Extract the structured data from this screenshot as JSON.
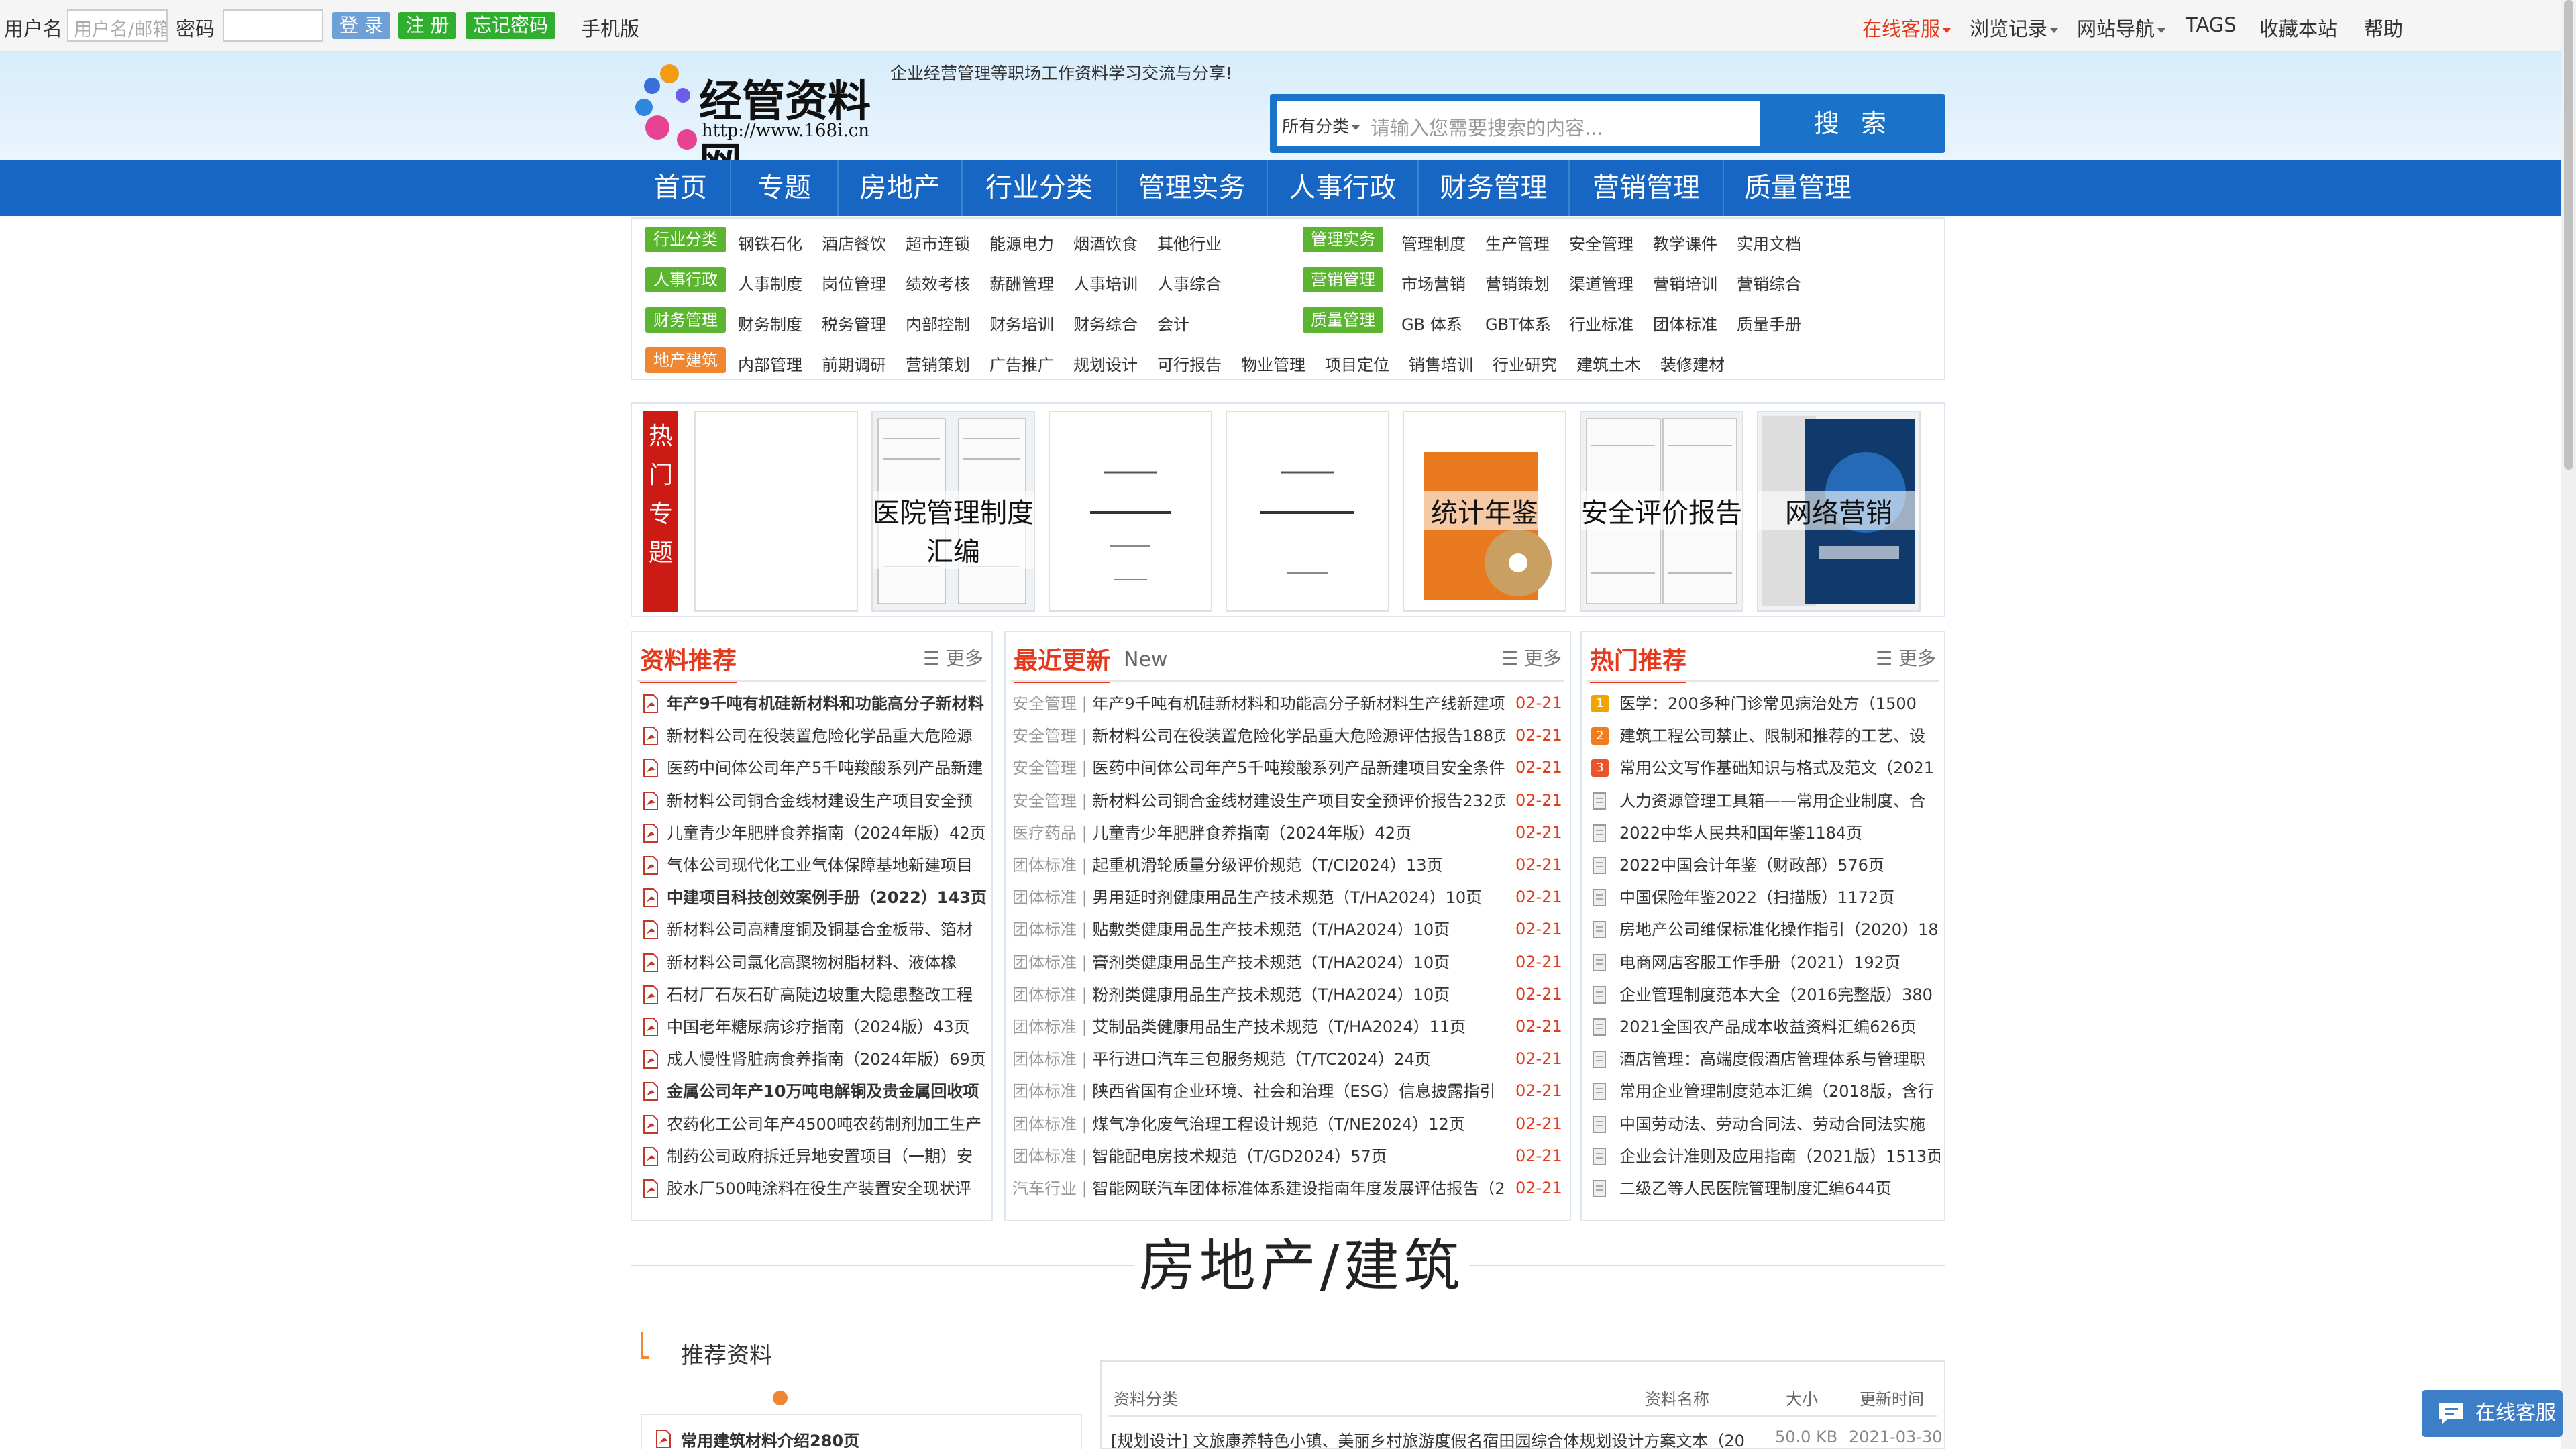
{
  "topbar": {
    "username_label": "用户名",
    "username_placeholder": "用户名/邮箱",
    "password_label": "密码",
    "login": "登 录",
    "register": "注 册",
    "forgot": "忘记密码",
    "mobile": "手机版",
    "right": [
      "在线客服",
      "浏览记录",
      "网站导航",
      "TAGS",
      "收藏本站",
      "帮助"
    ]
  },
  "header": {
    "slogan": "企业经营管理等职场工作资料学习交流与分享!",
    "logo_text": "经管资料网",
    "logo_url": "http://www.168i.cn",
    "search": {
      "category": "所有分类",
      "placeholder": "请输入您需要搜索的内容...",
      "button": "搜 索"
    }
  },
  "nav": [
    "首页",
    "专题",
    "房地产",
    "行业分类",
    "管理实务",
    "人事行政",
    "财务管理",
    "营销管理",
    "质量管理"
  ],
  "categories": [
    {
      "tag": "行业分类",
      "color": "green",
      "links": [
        "钢铁石化",
        "酒店餐饮",
        "超市连锁",
        "能源电力",
        "烟酒饮食",
        "其他行业"
      ],
      "tag2": "管理实务",
      "links2": [
        "管理制度",
        "生产管理",
        "安全管理",
        "教学课件",
        "实用文档"
      ]
    },
    {
      "tag": "人事行政",
      "color": "green",
      "links": [
        "人事制度",
        "岗位管理",
        "绩效考核",
        "薪酬管理",
        "人事培训",
        "人事综合"
      ],
      "tag2": "营销管理",
      "links2": [
        "市场营销",
        "营销策划",
        "渠道管理",
        "营销培训",
        "营销综合"
      ]
    },
    {
      "tag": "财务管理",
      "color": "green",
      "links": [
        "财务制度",
        "税务管理",
        "内部控制",
        "财务培训",
        "财务综合",
        "会计"
      ],
      "tag2": "质量管理",
      "links2": [
        "GB 体系",
        "GBT体系",
        "行业标准",
        "团体标准",
        "质量手册"
      ]
    },
    {
      "tag": "地产建筑",
      "color": "orange",
      "links": [
        "内部管理",
        "前期调研",
        "营销策划",
        "广告推广",
        "规划设计",
        "可行报告",
        "物业管理",
        "项目定位",
        "销售培训",
        "行业研究",
        "建筑土木",
        "装修建材"
      ],
      "tag2": "",
      "links2": []
    }
  ],
  "hot": {
    "label": [
      "热",
      "门",
      "专",
      "题"
    ],
    "captions": [
      "",
      "医院管理制度汇编",
      "",
      "",
      "统计年鉴",
      "安全评价报告",
      "网络营销"
    ]
  },
  "panels": {
    "recommend": {
      "title": "资料推荐",
      "more": "更多",
      "items": [
        {
          "t": "年产9千吨有机硅新材料和功能高分子新材料",
          "b": true
        },
        {
          "t": "新材料公司在役装置危险化学品重大危险源",
          "b": false
        },
        {
          "t": "医药中间体公司年产5千吨羧酸系列产品新建",
          "b": false
        },
        {
          "t": "新材料公司铜合金线材建设生产项目安全预",
          "b": false
        },
        {
          "t": "儿童青少年肥胖食养指南（2024年版）42页",
          "b": false
        },
        {
          "t": "气体公司现代化工业气体保障基地新建项目",
          "b": false
        },
        {
          "t": "中建项目科技创效案例手册（2022）143页",
          "b": true
        },
        {
          "t": "新材料公司高精度铜及铜基合金板带、箔材",
          "b": false
        },
        {
          "t": "新材料公司氯化高聚物树脂材料、液体橡",
          "b": false
        },
        {
          "t": "石材厂石灰石矿高陡边坡重大隐患整改工程",
          "b": false
        },
        {
          "t": "中国老年糖尿病诊疗指南（2024版）43页",
          "b": false
        },
        {
          "t": "成人慢性肾脏病食养指南（2024年版）69页",
          "b": false
        },
        {
          "t": "金属公司年产10万吨电解铜及贵金属回收项",
          "b": true
        },
        {
          "t": "农药化工公司年产4500吨农药制剂加工生产",
          "b": false
        },
        {
          "t": "制药公司政府拆迁异地安置项目（一期）安",
          "b": false
        },
        {
          "t": "胶水厂500吨涂料在役生产装置安全现状评",
          "b": false
        }
      ]
    },
    "recent": {
      "title": "最近更新",
      "sub": "New",
      "more": "更多",
      "items": [
        {
          "c": "安全管理",
          "t": "年产9千吨有机硅新材料和功能高分子新材料生产线新建项",
          "d": "02-21"
        },
        {
          "c": "安全管理",
          "t": "新材料公司在役装置危险化学品重大危险源评估报告188页",
          "d": "02-21"
        },
        {
          "c": "安全管理",
          "t": "医药中间体公司年产5千吨羧酸系列产品新建项目安全条件",
          "d": "02-21"
        },
        {
          "c": "安全管理",
          "t": "新材料公司铜合金线材建设生产项目安全预评价报告232页",
          "d": "02-21"
        },
        {
          "c": "医疗药品",
          "t": "儿童青少年肥胖食养指南（2024年版）42页",
          "d": "02-21"
        },
        {
          "c": "团体标准",
          "t": "起重机滑轮质量分级评价规范（T/CI2024）13页",
          "d": "02-21"
        },
        {
          "c": "团体标准",
          "t": "男用延时剂健康用品生产技术规范（T/HA2024）10页",
          "d": "02-21"
        },
        {
          "c": "团体标准",
          "t": "贴敷类健康用品生产技术规范（T/HA2024）10页",
          "d": "02-21"
        },
        {
          "c": "团体标准",
          "t": "膏剂类健康用品生产技术规范（T/HA2024）10页",
          "d": "02-21"
        },
        {
          "c": "团体标准",
          "t": "粉剂类健康用品生产技术规范（T/HA2024）10页",
          "d": "02-21"
        },
        {
          "c": "团体标准",
          "t": "艾制品类健康用品生产技术规范（T/HA2024）11页",
          "d": "02-21"
        },
        {
          "c": "团体标准",
          "t": "平行进口汽车三包服务规范（T/TC2024）24页",
          "d": "02-21"
        },
        {
          "c": "团体标准",
          "t": "陕西省国有企业环境、社会和治理（ESG）信息披露指引",
          "d": "02-21"
        },
        {
          "c": "团体标准",
          "t": "煤气净化废气治理工程设计规范（T/NE2024）12页",
          "d": "02-21"
        },
        {
          "c": "团体标准",
          "t": "智能配电房技术规范（T/GD2024）57页",
          "d": "02-21"
        },
        {
          "c": "汽车行业",
          "t": "智能网联汽车团体标准体系建设指南年度发展评估报告（20",
          "d": "02-21"
        }
      ]
    },
    "hotrec": {
      "title": "热门推荐",
      "more": "更多",
      "items": [
        "医学：200多种门诊常见病治处方（1500",
        "建筑工程公司禁止、限制和推荐的工艺、设",
        "常用公文写作基础知识与格式及范文（2021",
        "人力资源管理工具箱——常用企业制度、合",
        "2022中华人民共和国年鉴1184页",
        "2022中国会计年鉴（财政部）576页",
        "中国保险年鉴2022（扫描版）1172页",
        "房地产公司维保标准化操作指引（2020）18",
        "电商网店客服工作手册（2021）192页",
        "企业管理制度范本大全（2016完整版）380",
        "2021全国农产品成本收益资料汇编626页",
        "酒店管理：高端度假酒店管理体系与管理职",
        "常用企业管理制度范本汇编（2018版，含行",
        "中国劳动法、劳动合同法、劳动合同法实施",
        "企业会计准则及应用指南（2021版）1513页",
        "二级乙等人民医院管理制度汇编644页"
      ]
    }
  },
  "section": {
    "title": "房地产/建筑",
    "sub": "推荐资料",
    "left_item": "常用建筑材料介绍280页",
    "table": {
      "headers": [
        "资料分类",
        "资料名称",
        "大小",
        "更新时间"
      ],
      "row": {
        "text": "[规划设计] 文旅康养特色小镇、美丽乡村旅游度假名宿田园综合体规划设计方案文本（20",
        "size": "50.0 KB",
        "date": "2021-03-30"
      }
    }
  },
  "chat": "在线客服"
}
